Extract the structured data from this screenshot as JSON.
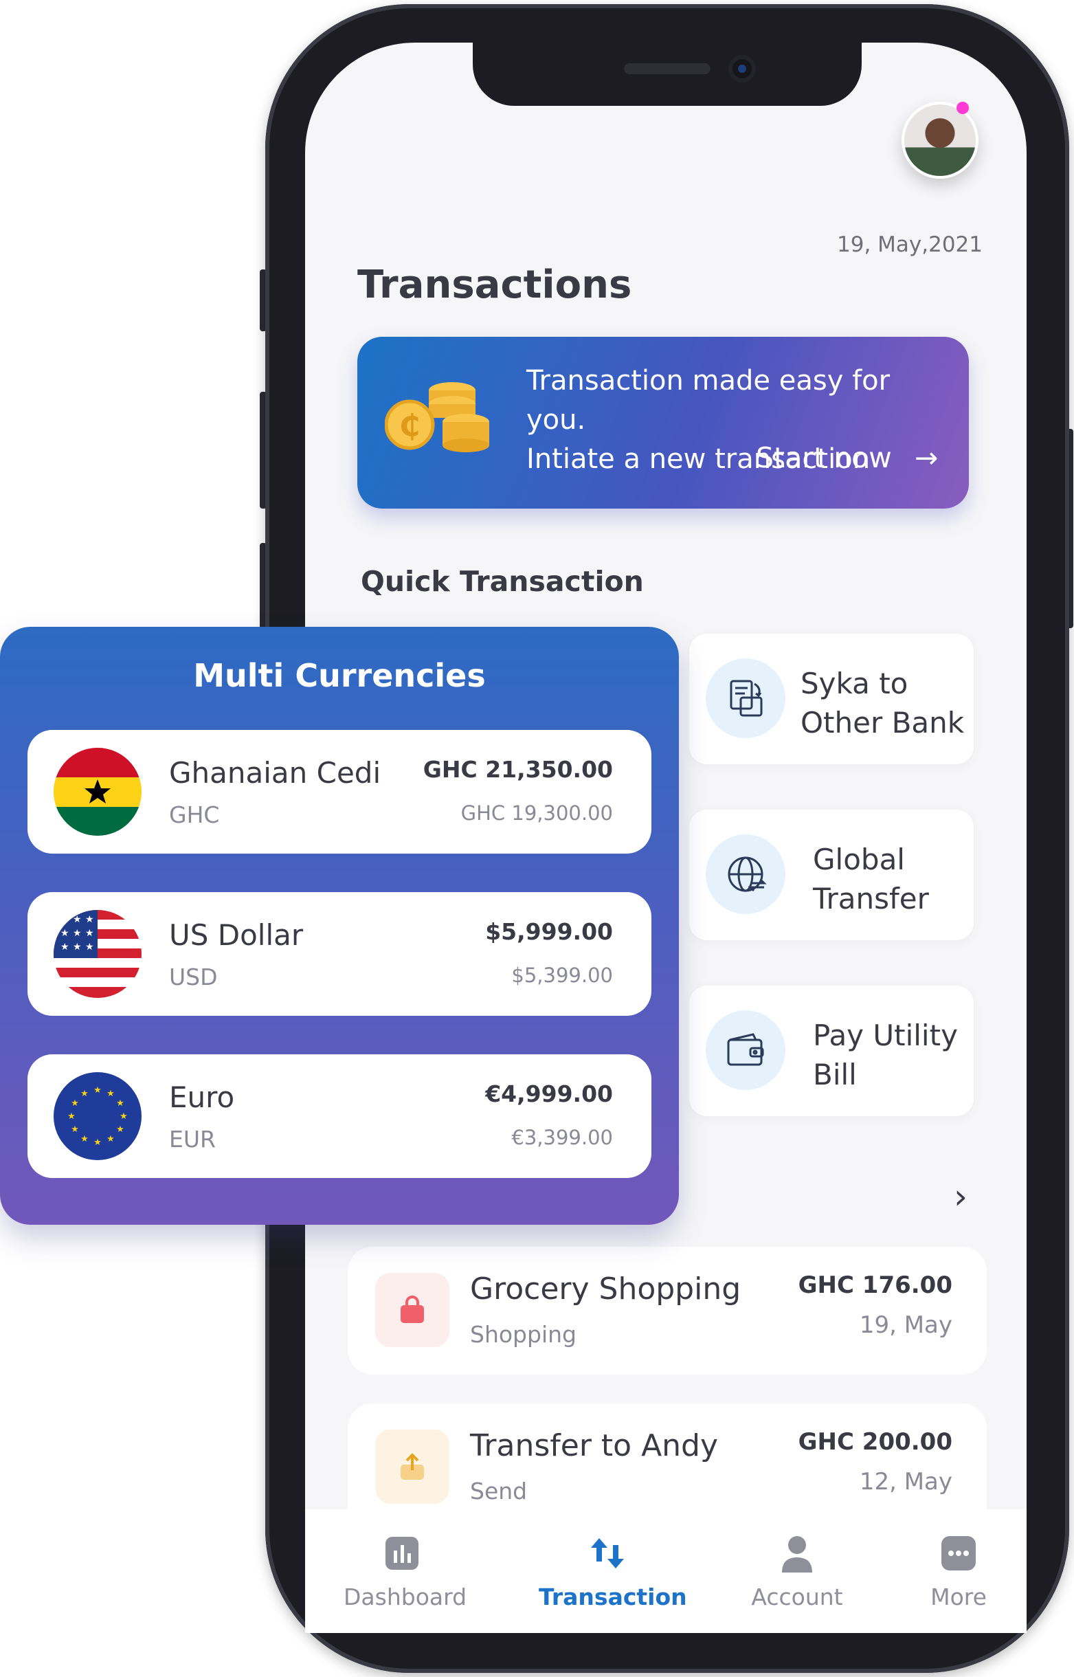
{
  "header": {
    "date": "19, May,2021",
    "title": "Transactions"
  },
  "banner": {
    "line1": "Transaction made easy for you.",
    "line2": "Intiate a new transaction",
    "cta": "Start now",
    "cta_arrow": "→",
    "icon": "coins-icon"
  },
  "quick": {
    "title": "Quick Transaction",
    "tiles": [
      {
        "label": "Syka to Other Bank",
        "icon": "bank-transfer-icon"
      },
      {
        "label": "Global Transfer",
        "icon": "globe-transfer-icon"
      },
      {
        "label": "Pay Utility Bill",
        "icon": "wallet-icon"
      }
    ],
    "more_icon": "chevron-right-icon"
  },
  "recent": [
    {
      "title": "Grocery Shopping",
      "category": "Shopping",
      "amount": "GHC 176.00",
      "date": "19, May",
      "icon": "shopping-bag-icon",
      "icon_color": "#f0606a",
      "icon_bg": "#fdeeee"
    },
    {
      "title": "Transfer to Andy",
      "category": "Send",
      "amount": "GHC 200.00",
      "date": "12, May",
      "icon": "send-up-icon",
      "icon_color": "#f2b84a",
      "icon_bg": "#fdf3e2"
    }
  ],
  "nav": {
    "items": [
      {
        "label": "Dashboard",
        "icon": "bar-chart-icon"
      },
      {
        "label": "Transaction",
        "icon": "transfer-arrows-icon"
      },
      {
        "label": "Account",
        "icon": "person-icon"
      },
      {
        "label": "More",
        "icon": "more-dots-icon"
      }
    ],
    "active": "Transaction"
  },
  "currencies": {
    "title": "Multi Currencies",
    "rows": [
      {
        "name": "Ghanaian Cedi",
        "code": "GHC",
        "balance": "GHC 21,350.00",
        "available": "GHC 19,300.00",
        "flag": "ghana-flag-icon"
      },
      {
        "name": "US Dollar",
        "code": "USD",
        "balance": "$5,999.00",
        "available": "$5,399.00",
        "flag": "usa-flag-icon"
      },
      {
        "name": "Euro",
        "code": "EUR",
        "balance": "€4,999.00",
        "available": "€3,399.00",
        "flag": "eu-flag-icon"
      }
    ]
  },
  "colors": {
    "accent": "#1c73c7",
    "banner_start": "#1c73c7",
    "banner_end": "#8a5cbf",
    "text": "#3a3a44",
    "muted": "#8a8a96"
  }
}
